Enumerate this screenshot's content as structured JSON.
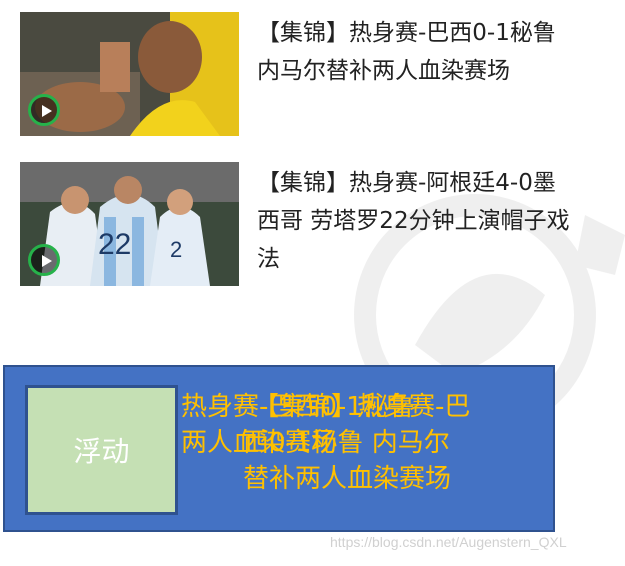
{
  "news": [
    {
      "title": "【集锦】热身赛-巴西0-1秘鲁 内马尔替补两人血染赛场",
      "thumbnail_icon": "play-icon"
    },
    {
      "title": "【集锦】热身赛-阿根廷4-0墨西哥 劳塔罗22分钟上演帽子戏法",
      "thumbnail_icon": "play-icon"
    }
  ],
  "float_demo": {
    "box_label": "浮动",
    "text_behind_lines": [
      "热身赛-巴西0-1秘鲁",
      "两人血染赛场"
    ],
    "text_front_lines": [
      "【集锦】热身赛-巴",
      "西0-1秘鲁 内马尔",
      "替补两人血染赛场"
    ],
    "colors": {
      "background": "#4472c4",
      "box": "#c5e0b4",
      "text": "#ffc000"
    }
  },
  "watermark_text": "https://blog.csdn.net/Augenstern_QXL"
}
